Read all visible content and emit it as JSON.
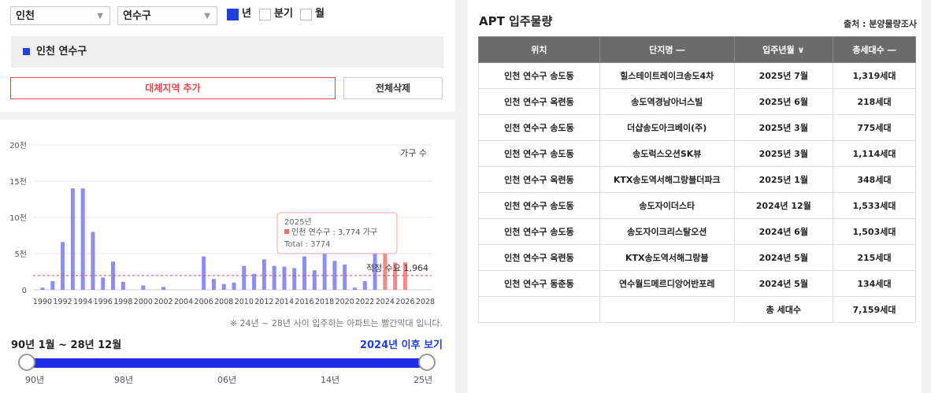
{
  "filters": {
    "city": "인천",
    "district": "연수구",
    "period_options": [
      {
        "label": "년",
        "checked": true
      },
      {
        "label": "분기",
        "checked": false
      },
      {
        "label": "월",
        "checked": false
      }
    ]
  },
  "region": {
    "label": "인천 연수구"
  },
  "buttons": {
    "add_region": "대체지역 추가",
    "delete_all": "전체삭제"
  },
  "chart_data": {
    "type": "bar",
    "ylabel": "가구 수",
    "ytick_labels": [
      "0",
      "5천",
      "10천",
      "15천",
      "20천"
    ],
    "ylim": [
      0,
      20000
    ],
    "xtick_labels": [
      "1990",
      "1992",
      "1994",
      "1996",
      "1998",
      "2000",
      "2002",
      "2004",
      "2006",
      "2008",
      "2010",
      "2012",
      "2014",
      "2016",
      "2018",
      "2020",
      "2022",
      "2024",
      "2026",
      "2028"
    ],
    "x": [
      1990,
      1991,
      1992,
      1993,
      1994,
      1995,
      1996,
      1997,
      1998,
      1999,
      2000,
      2001,
      2002,
      2003,
      2004,
      2005,
      2006,
      2007,
      2008,
      2009,
      2010,
      2011,
      2012,
      2013,
      2014,
      2015,
      2016,
      2017,
      2018,
      2019,
      2020,
      2021,
      2022,
      2023,
      2024,
      2025,
      2026,
      2027,
      2028
    ],
    "values": [
      300,
      1200,
      6600,
      14000,
      14000,
      8000,
      1700,
      3900,
      1100,
      0,
      600,
      0,
      400,
      0,
      0,
      0,
      4600,
      1500,
      800,
      1000,
      3300,
      2200,
      4200,
      3300,
      3200,
      3000,
      4600,
      2700,
      6200,
      4000,
      3500,
      300,
      1200,
      5600,
      5700,
      3774,
      3800,
      0,
      0
    ],
    "highlight_from": 2024,
    "bar_color": "#8c8ef5",
    "highlight_color": "#f26b6b",
    "reference_line": {
      "value": 1964,
      "label": "적정 수요 1,964",
      "color": "#e8454a"
    },
    "tooltip": {
      "year": "2025년",
      "series": "인천 연수구 : 3,774 가구",
      "total": "Total : 3774"
    }
  },
  "note": "※ 24년 ~ 28년 사이 입주하는 아파트는 빨간막대 입니다.",
  "range": {
    "label": "90년 1월 ~ 28년 12월",
    "link": "2024년 이후 보기",
    "ticks": [
      "90년",
      "98년",
      "06년",
      "14년",
      "25년"
    ]
  },
  "table": {
    "title": "APT 입주물량",
    "source": "출처 : 분양물량조사",
    "headers": [
      "위치",
      "단지명 ―",
      "입주년월 ∨",
      "총세대수 ―"
    ],
    "rows": [
      [
        "인천 연수구 송도동",
        "힐스테이트레이크송도4차",
        "2025년 7월",
        "1,319세대"
      ],
      [
        "인천 연수구 옥련동",
        "송도역경남아너스빌",
        "2025년 6월",
        "218세대"
      ],
      [
        "인천 연수구 송도동",
        "더샵송도아크베이(주)",
        "2025년 3월",
        "775세대"
      ],
      [
        "인천 연수구 송도동",
        "송도럭스오션SK뷰",
        "2025년 3월",
        "1,114세대"
      ],
      [
        "인천 연수구 옥련동",
        "KTX송도역서해그랑블더파크",
        "2025년 1월",
        "348세대"
      ],
      [
        "인천 연수구 송도동",
        "송도자이더스타",
        "2024년 12월",
        "1,533세대"
      ],
      [
        "인천 연수구 송도동",
        "송도자이크리스탈오션",
        "2024년 6월",
        "1,503세대"
      ],
      [
        "인천 연수구 옥련동",
        "KTX송도역서해그랑블",
        "2024년 5월",
        "215세대"
      ],
      [
        "인천 연수구 동춘동",
        "연수월드메르디앙어반포레",
        "2024년 5월",
        "134세대"
      ]
    ],
    "total_label": "총 세대수",
    "total_value": "7,159세대"
  }
}
